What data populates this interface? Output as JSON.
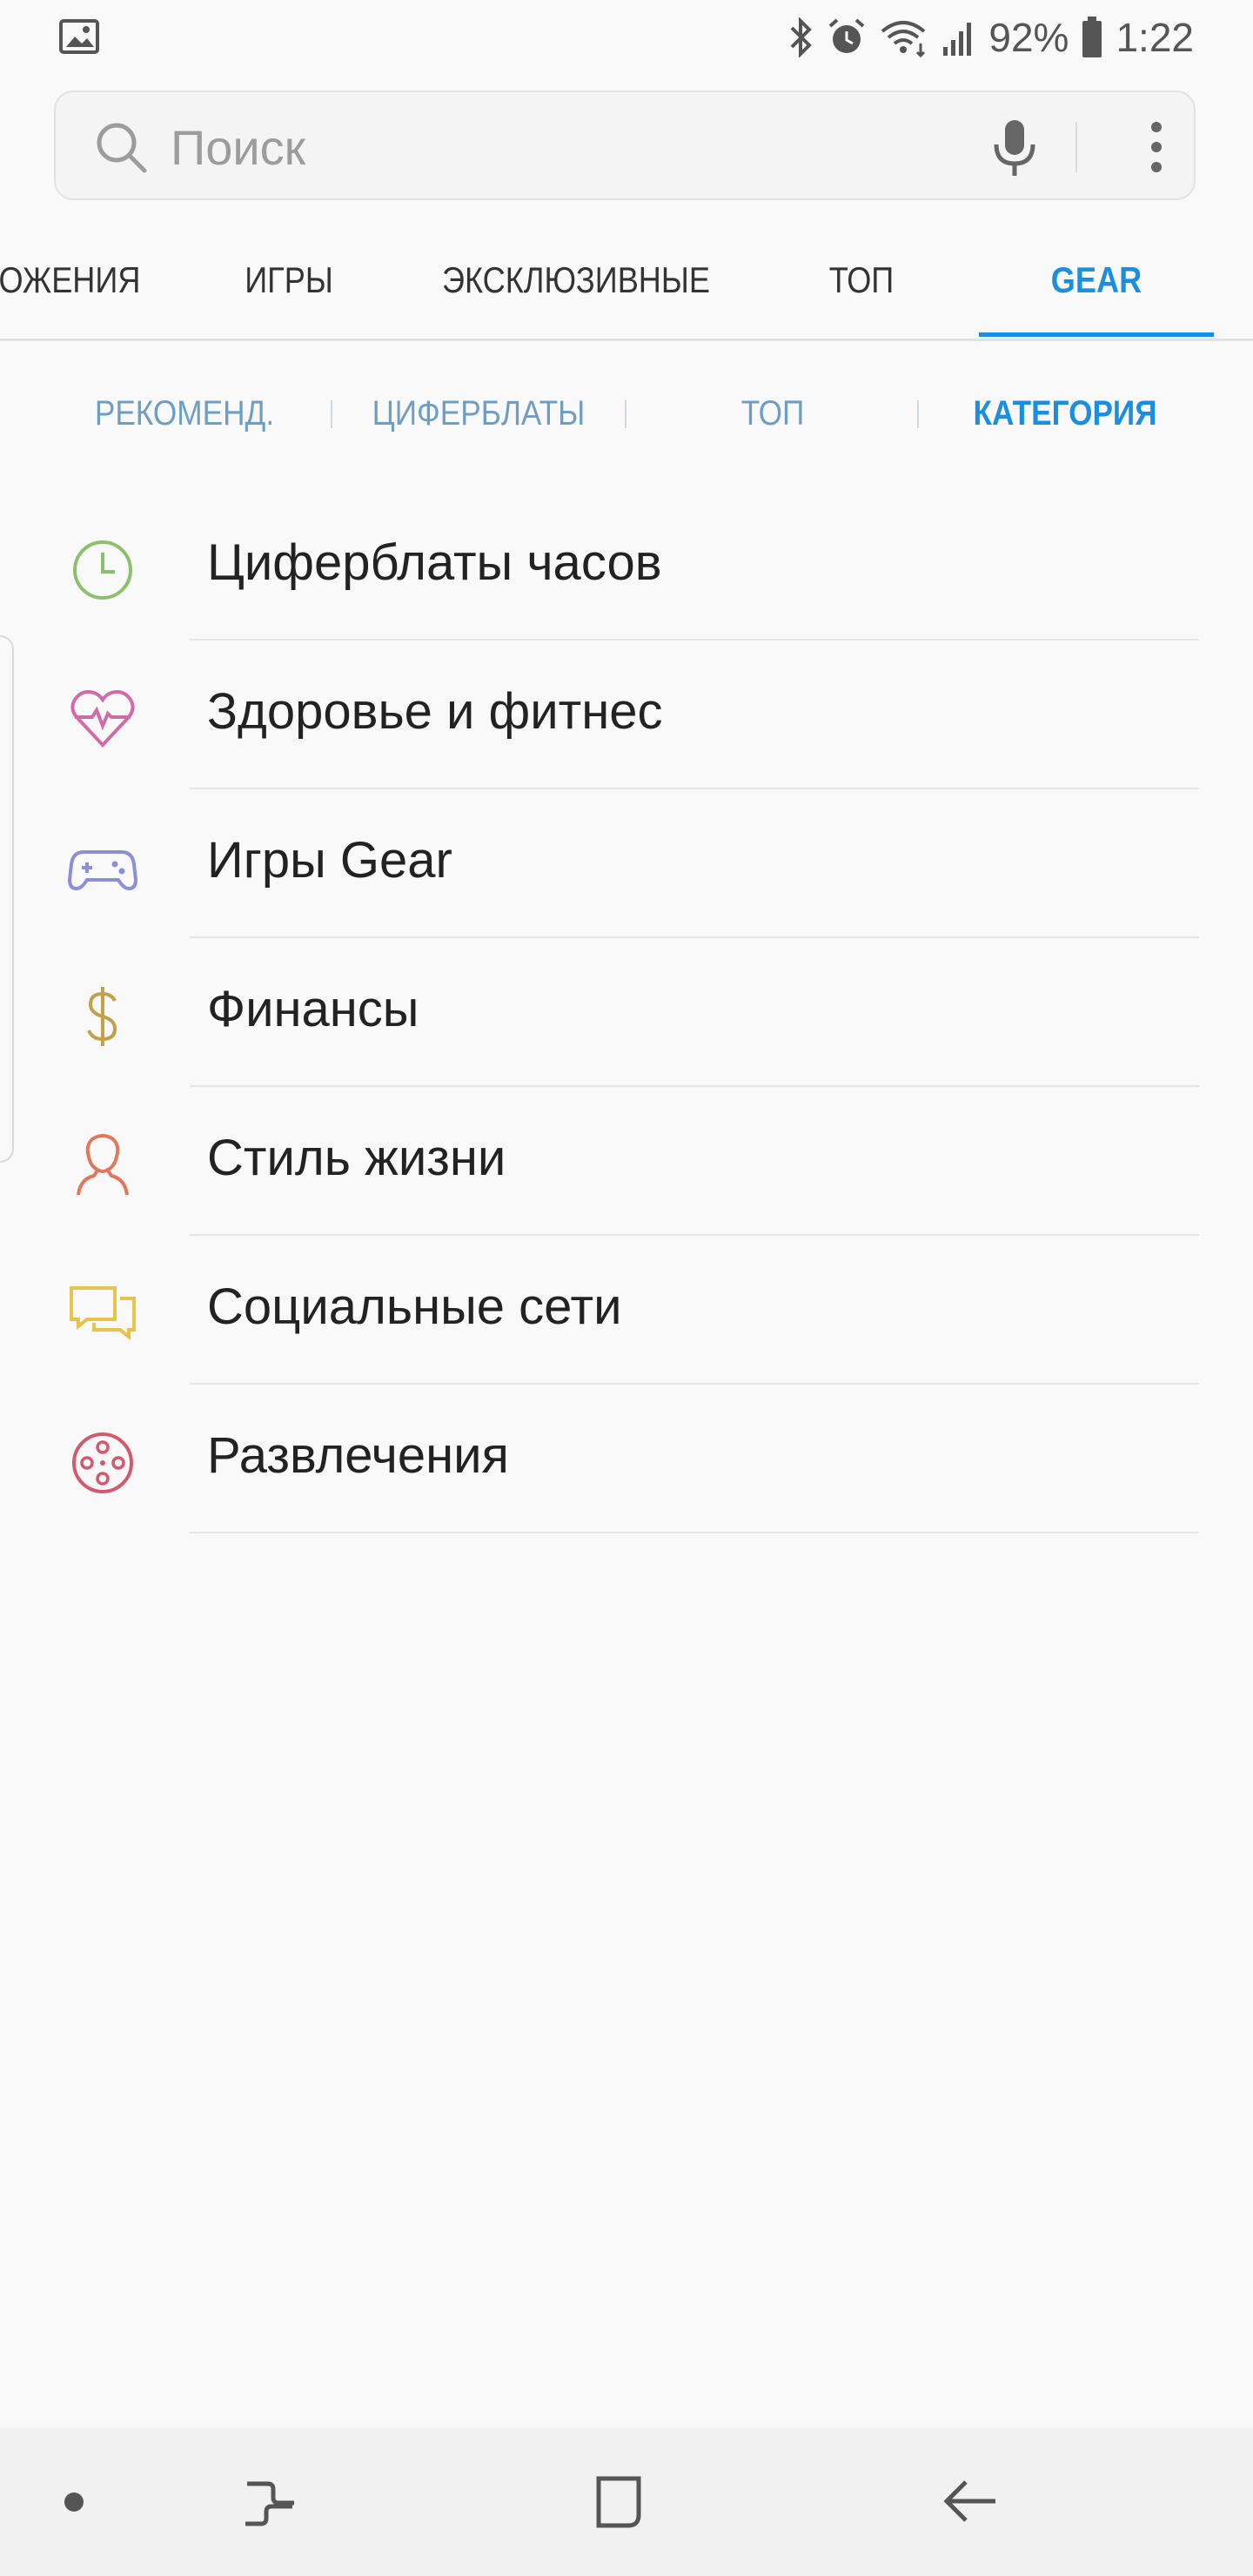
{
  "status_bar": {
    "battery": "92%",
    "time": "1:22",
    "icons": [
      "gallery-icon",
      "bluetooth-icon",
      "alarm-icon",
      "wifi-icon",
      "signal-icon",
      "battery-icon"
    ]
  },
  "search": {
    "placeholder": "Поиск",
    "icons": [
      "search-icon",
      "mic-icon",
      "more-vert-icon"
    ]
  },
  "main_tabs": [
    {
      "label": "ОЖЕНИЯ"
    },
    {
      "label": "ИГРЫ"
    },
    {
      "label": "ЭКСКЛЮЗИВНЫЕ"
    },
    {
      "label": "ТОП"
    },
    {
      "label": "GEAR",
      "active": true
    }
  ],
  "sub_tabs": [
    {
      "label": "РЕКОМЕНД."
    },
    {
      "label": "ЦИФЕРБЛАТЫ"
    },
    {
      "label": "ТОП"
    },
    {
      "label": "КАТЕГОРИЯ",
      "active": true
    }
  ],
  "categories": [
    {
      "label": "Циферблаты часов",
      "icon": "clock-icon",
      "color": "#8cc06a"
    },
    {
      "label": "Здоровье и фитнес",
      "icon": "heart-pulse-icon",
      "color": "#d36aa8"
    },
    {
      "label": "Игры Gear",
      "icon": "gamepad-icon",
      "color": "#8a8fd8"
    },
    {
      "label": "Финансы",
      "icon": "dollar-icon",
      "color": "#c2a14a"
    },
    {
      "label": "Стиль жизни",
      "icon": "person-icon",
      "color": "#e0785c"
    },
    {
      "label": "Социальные сети",
      "icon": "chat-icon",
      "color": "#e8c24a"
    },
    {
      "label": "Развлечения",
      "icon": "film-reel-icon",
      "color": "#d35a6e"
    }
  ],
  "colors": {
    "accent": "#1a8fe0",
    "subtab": "#6f9ec4",
    "background": "#f9f9f9"
  },
  "nav_bar": {
    "icons": [
      "dot-icon",
      "recent-apps-icon",
      "home-icon",
      "back-icon"
    ]
  }
}
